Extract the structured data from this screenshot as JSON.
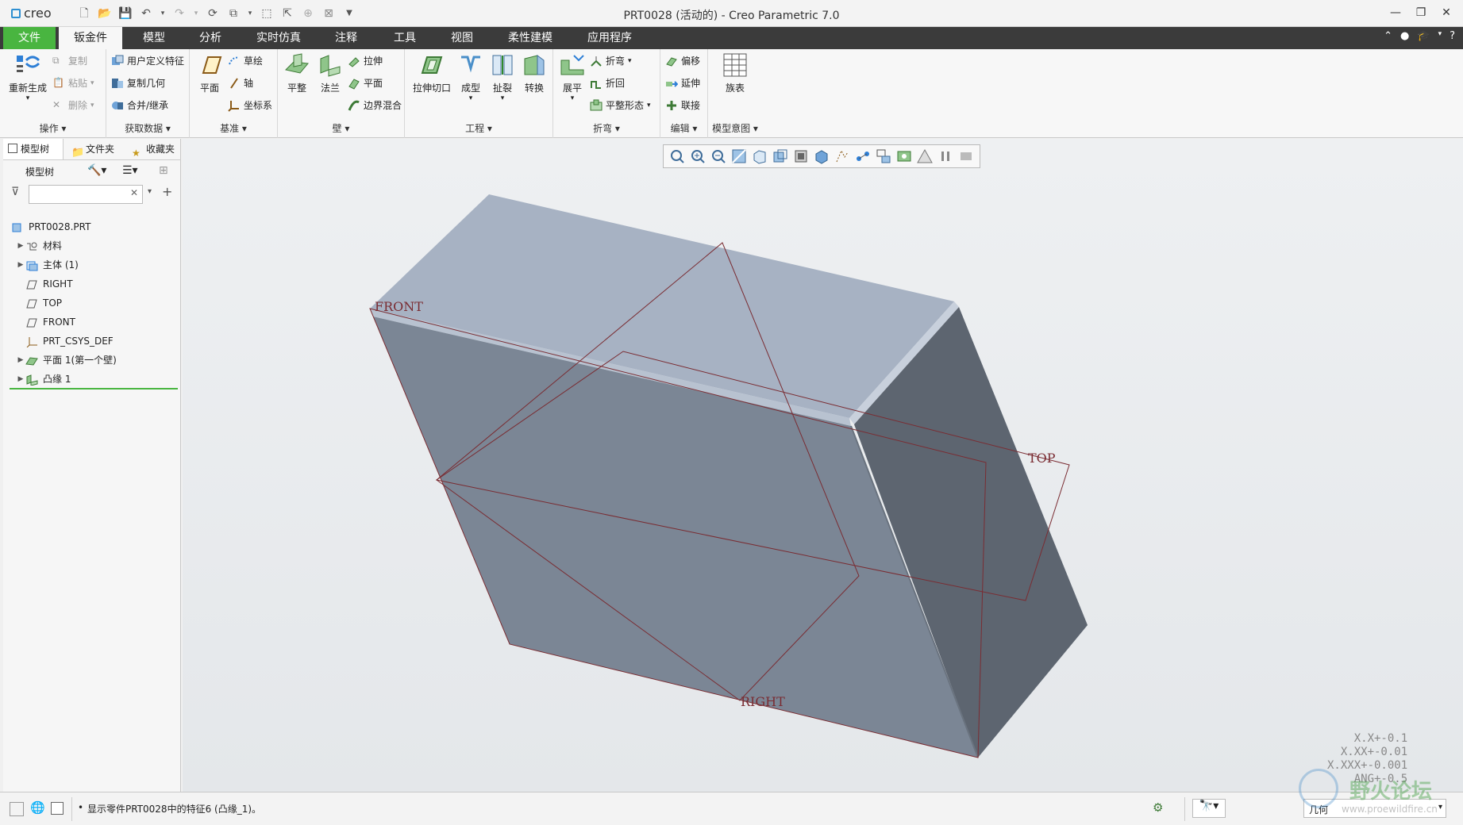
{
  "app": {
    "logo_text": "creo",
    "window_title": "PRT0028 (活动的) - Creo Parametric 7.0"
  },
  "tabs": {
    "file": "文件",
    "sheetmetal": "钣金件",
    "model": "模型",
    "analysis": "分析",
    "simulation": "实时仿真",
    "annotate": "注释",
    "tools": "工具",
    "view": "视图",
    "flexible": "柔性建模",
    "apps": "应用程序"
  },
  "ribbon": {
    "operations": {
      "regenerate": "重新生成",
      "copy": "复制",
      "paste": "粘贴",
      "delete": "删除",
      "label": "操作"
    },
    "getdata": {
      "udf": "用户定义特征",
      "copygeom": "复制几何",
      "merge": "合并/继承",
      "label": "获取数据"
    },
    "datum": {
      "plane": "平面",
      "sketch": "草绘",
      "axis": "轴",
      "csys": "坐标系",
      "label": "基准"
    },
    "wall": {
      "flat": "平整",
      "flange": "法兰",
      "extrude": "拉伸",
      "planar": "平面",
      "blend": "边界混合",
      "label": "壁"
    },
    "engineering": {
      "cut": "拉伸切口",
      "form": "成型",
      "rip": "扯裂",
      "convert": "转换",
      "label": "工程"
    },
    "bend": {
      "unbend": "展平",
      "bend": "折弯",
      "bendback": "折回",
      "flatform": "平整形态",
      "label": "折弯"
    },
    "edit": {
      "offset": "偏移",
      "extend": "延伸",
      "join": "联接",
      "label": "编辑"
    },
    "intent": {
      "family": "族表",
      "label": "模型意图"
    }
  },
  "sidebar": {
    "tabs": [
      "模型树",
      "文件夹",
      "收藏夹"
    ],
    "tree_header": "模型树",
    "search_placeholder": "",
    "items": [
      {
        "label": "PRT0028.PRT"
      },
      {
        "label": "材料"
      },
      {
        "label": "主体 (1)"
      },
      {
        "label": "RIGHT"
      },
      {
        "label": "TOP"
      },
      {
        "label": "FRONT"
      },
      {
        "label": "PRT_CSYS_DEF"
      },
      {
        "label": "平面 1(第一个壁)"
      },
      {
        "label": "凸缘 1"
      }
    ]
  },
  "viewport": {
    "planes": {
      "front": "FRONT",
      "top": "TOP",
      "right": "RIGHT"
    },
    "tolerances": [
      "X.X+-0.1",
      "X.XX+-0.01",
      "X.XXX+-0.001",
      "ANG+-0.5"
    ]
  },
  "status": {
    "message": "显示零件PRT0028中的特征6 (凸缘_1)。",
    "filter": "几何",
    "watermark_cn": "野火论坛",
    "watermark_url": "www.proewildfire.cn"
  },
  "colors": {
    "file_tab": "#49b540",
    "tab_bar": "#3b3b3b",
    "body_face": "#7b8695",
    "body_top": "#a7b2c3",
    "body_side": "#5d6570",
    "datum": "#7a2c32"
  }
}
